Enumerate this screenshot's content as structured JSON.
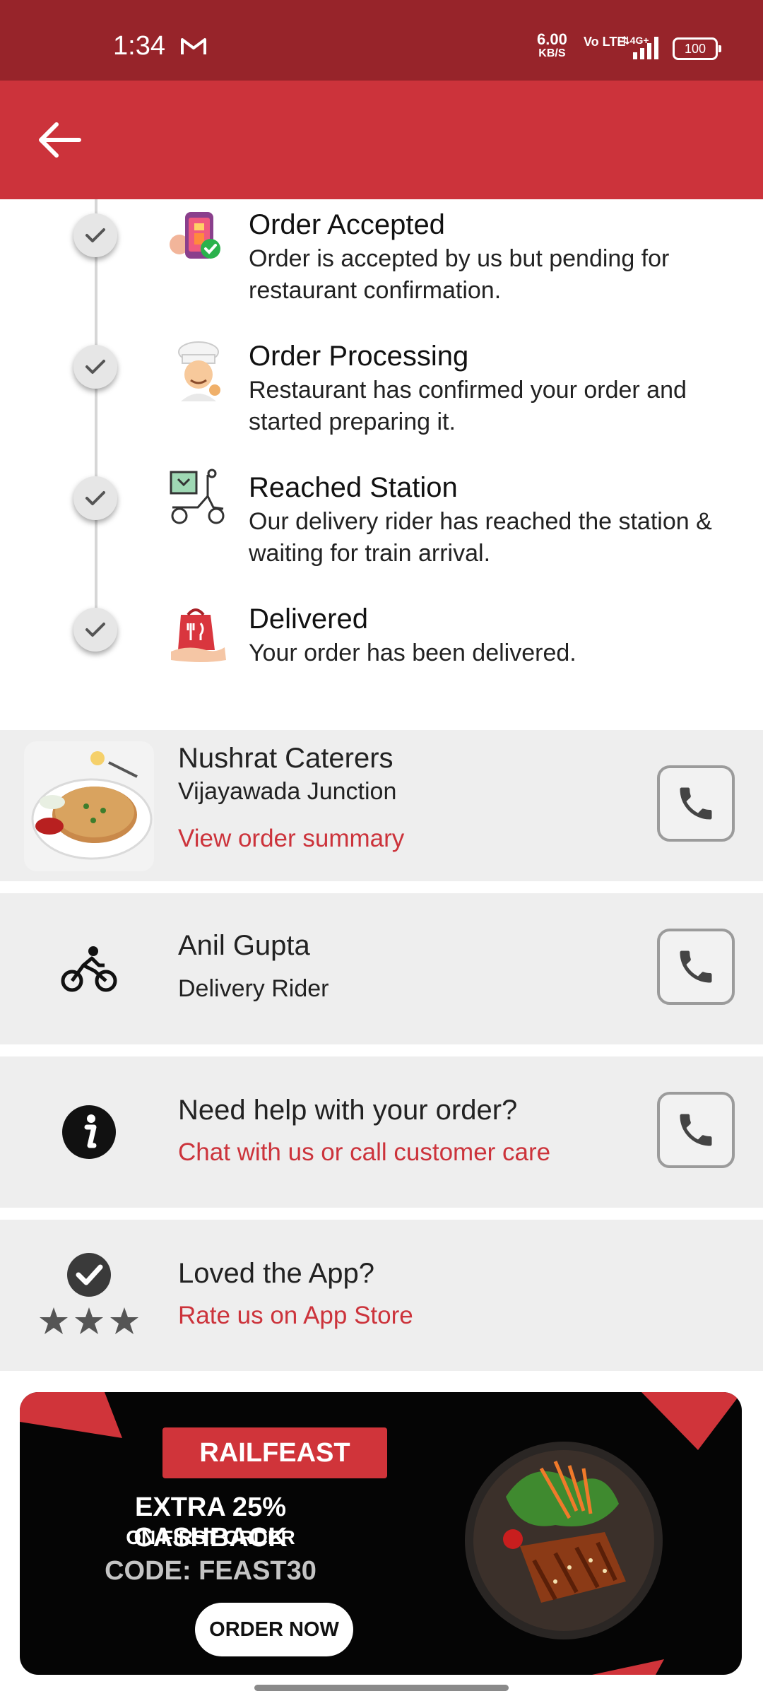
{
  "status_bar": {
    "time": "1:34",
    "speed_value": "6.00",
    "speed_unit": "KB/S",
    "volte": "Vo LTE",
    "network": "4G+",
    "battery": "100"
  },
  "colors": {
    "status_bar": "#97242a",
    "app_bar": "#cc333b",
    "accent_text": "#cc333b",
    "card_bg": "#eeeeee"
  },
  "app_bar": {
    "back_icon": "arrow-left-icon"
  },
  "timeline": {
    "steps": [
      {
        "title": "Order Accepted",
        "description": "Order is accepted by us but pending for restaurant confirmation.",
        "icon": "phone-order-accepted-icon",
        "done": true
      },
      {
        "title": "Order Processing",
        "description": "Restaurant has confirmed your order and started preparing it.",
        "icon": "chef-icon",
        "done": true
      },
      {
        "title": "Reached Station",
        "description": "Our delivery rider has reached the station & waiting for train arrival.",
        "icon": "delivery-scooter-icon",
        "done": true
      },
      {
        "title": "Delivered",
        "description": "Your order has been delivered.",
        "icon": "food-bag-hand-icon",
        "done": true
      }
    ]
  },
  "restaurant": {
    "name": "Nushrat Caterers",
    "station": "Vijayawada Junction",
    "link": "View order summary"
  },
  "rider": {
    "name": "Anil Gupta",
    "role": "Delivery Rider"
  },
  "help": {
    "title": "Need help with your order?",
    "link": "Chat with us or call customer care"
  },
  "rate": {
    "title": "Loved the App?",
    "link": "Rate us on App Store"
  },
  "banner": {
    "brand": "RAILFEAST",
    "line1": "EXTRA 25% CASHBACK",
    "line2": "ON  FIRST ORDER",
    "code": "CODE: FEAST30",
    "cta": "ORDER NOW"
  }
}
